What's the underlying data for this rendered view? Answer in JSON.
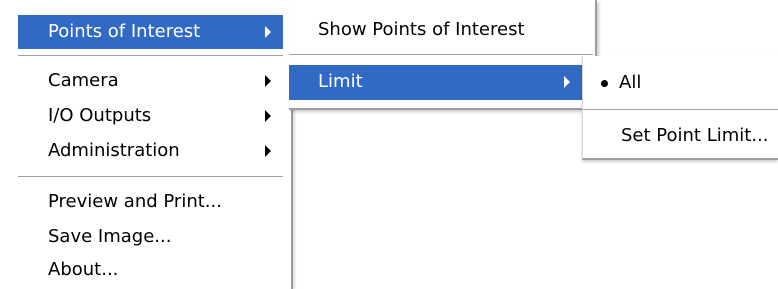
{
  "main_menu": {
    "items": [
      {
        "label": "Points of Interest",
        "has_submenu": true,
        "selected": true
      },
      {
        "label": "Camera",
        "has_submenu": true
      },
      {
        "label": "I/O Outputs",
        "has_submenu": true
      },
      {
        "label": "Administration",
        "has_submenu": true
      },
      {
        "label": "Preview and Print...",
        "has_submenu": false
      },
      {
        "label": "Save Image...",
        "has_submenu": false
      },
      {
        "label": "About...",
        "has_submenu": false
      }
    ]
  },
  "poi_submenu": {
    "items": [
      {
        "label": "Show Points of Interest",
        "has_submenu": false
      },
      {
        "label": "Limit",
        "has_submenu": true,
        "selected": true
      }
    ]
  },
  "limit_submenu": {
    "items": [
      {
        "label": "All",
        "checked": true
      },
      {
        "label": "Set Point Limit...",
        "checked": false
      }
    ]
  },
  "colors": {
    "highlight": "#316ac5",
    "highlight_text": "#ffffff",
    "separator": "#a0a0a0"
  }
}
